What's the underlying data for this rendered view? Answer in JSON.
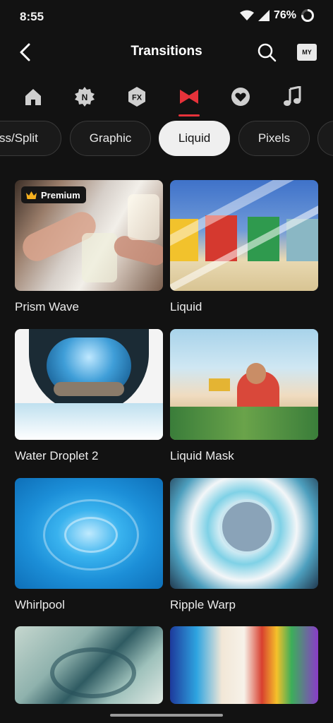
{
  "status": {
    "time": "8:55",
    "battery": "76%"
  },
  "header": {
    "title": "Transitions",
    "my_badge": "MY"
  },
  "categories": [
    {
      "icon": "home-icon"
    },
    {
      "icon": "new-badge-icon"
    },
    {
      "icon": "fx-icon"
    },
    {
      "icon": "bowtie-icon",
      "selected": true
    },
    {
      "icon": "heart-icon"
    },
    {
      "icon": "music-note-icon"
    }
  ],
  "chips": [
    {
      "label": "ss/Split"
    },
    {
      "label": "Graphic"
    },
    {
      "label": "Liquid",
      "selected": true
    },
    {
      "label": "Pixels"
    }
  ],
  "grid": [
    {
      "label": "Prism Wave",
      "badge": "Premium"
    },
    {
      "label": "Liquid"
    },
    {
      "label": "Water Droplet 2"
    },
    {
      "label": "Liquid Mask"
    },
    {
      "label": "Whirlpool"
    },
    {
      "label": "Ripple Warp"
    },
    {
      "label": ""
    },
    {
      "label": ""
    }
  ],
  "colors": {
    "accent": "#e7323a",
    "background": "#121212"
  }
}
